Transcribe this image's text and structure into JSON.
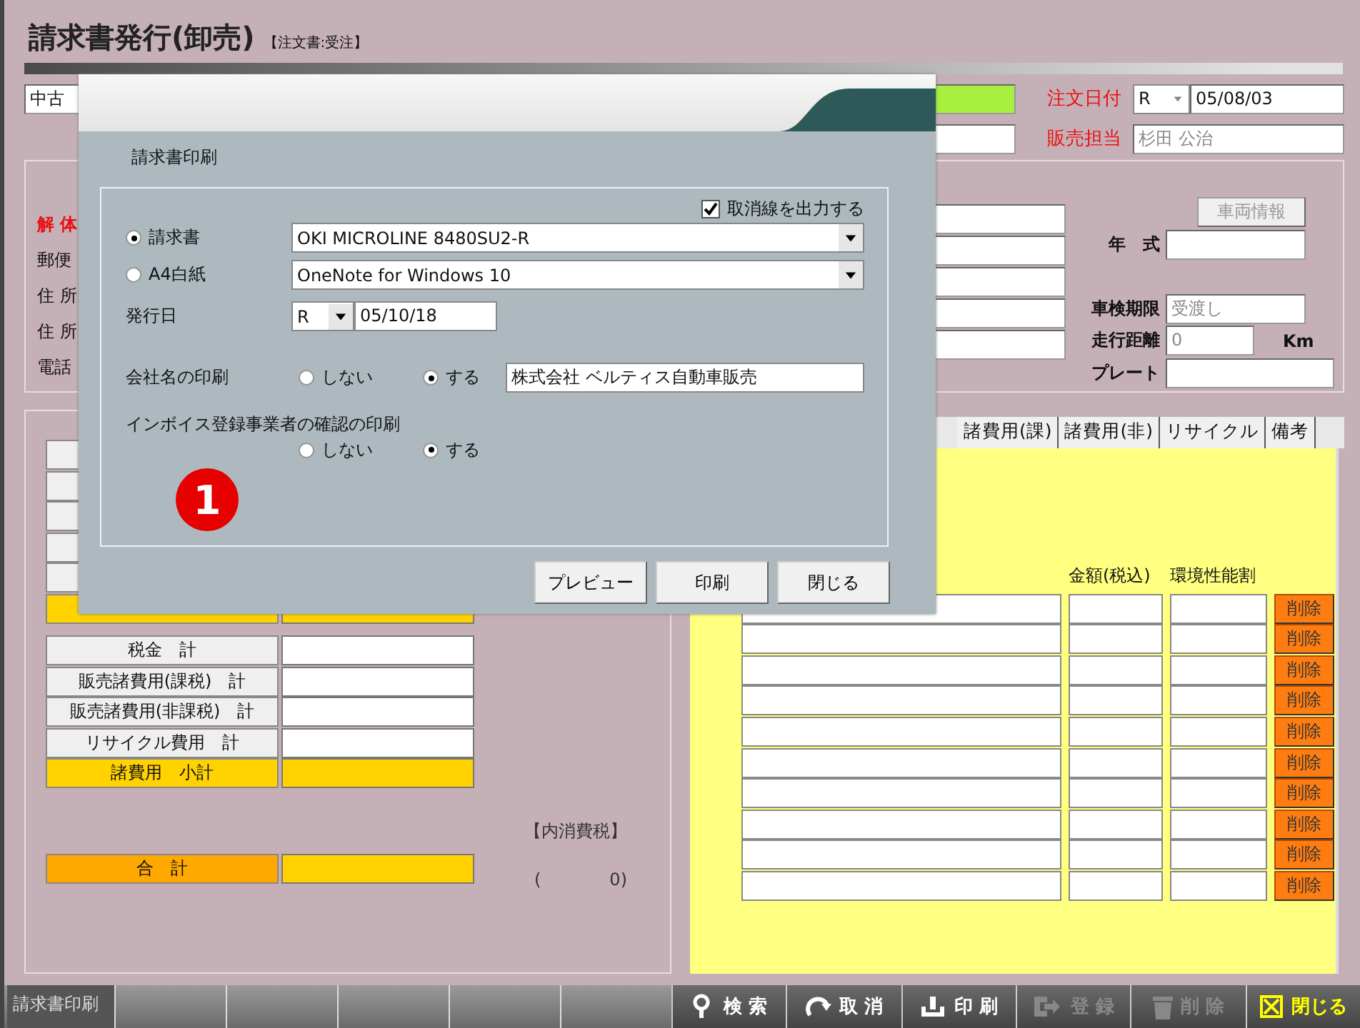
{
  "window": {
    "title": "請求書発行(卸売)",
    "subtitle": "【注文書:受注】"
  },
  "header": {
    "category": "中古",
    "order_date_label": "注文日付",
    "order_date_era": "R",
    "order_date": "05/08/03",
    "sales_rep_label": "販売担当",
    "sales_rep": "杉田 公治"
  },
  "customer": {
    "labels": [
      {
        "text": "解 体",
        "kind": "alert"
      },
      {
        "text": "郵便",
        "kind": "plain"
      },
      {
        "text": "住 所",
        "kind": "plain"
      },
      {
        "text": "住 所",
        "kind": "plain"
      },
      {
        "text": "電話",
        "kind": "plain"
      }
    ]
  },
  "vehicle": {
    "info_button": {
      "label": "車両情報",
      "disabled": true
    },
    "year_label": "年　式",
    "inspection_label": "車検期限",
    "inspection": "受渡し",
    "mileage_label": "走行距離",
    "mileage": "0",
    "mileage_unit": "Km",
    "plate_label": "プレート"
  },
  "totals": [
    {
      "label": "税金　計",
      "kind": "item"
    },
    {
      "label": "販売諸費用(課税)　計",
      "kind": "item"
    },
    {
      "label": "販売諸費用(非課税)　計",
      "kind": "item"
    },
    {
      "label": "リサイクル費用　計",
      "kind": "item"
    },
    {
      "label": "諸費用　小計",
      "kind": "subtotal"
    }
  ],
  "grand_total": {
    "label": "合　計"
  },
  "tax_note": {
    "label": "【内消費税】",
    "value": "(　　　　0)"
  },
  "tabs": [
    {
      "label": "諸費用(課)",
      "selected": false
    },
    {
      "label": "諸費用(非)",
      "selected": false
    },
    {
      "label": "リサイクル",
      "selected": false
    },
    {
      "label": "備考",
      "selected": false
    }
  ],
  "fees": {
    "columns": [
      "金額(税込)",
      "環境性能割"
    ],
    "rows": [
      {
        "action": "削除"
      },
      {
        "action": "削除"
      },
      {
        "action": "削除"
      },
      {
        "action": "削除"
      },
      {
        "action": "削除"
      },
      {
        "action": "削除"
      },
      {
        "action": "削除"
      },
      {
        "action": "削除"
      },
      {
        "action": "削除"
      },
      {
        "action": "削除"
      }
    ]
  },
  "toolbar": {
    "tab": "請求書印刷",
    "buttons": [
      {
        "label": "検 索",
        "kind": "search",
        "disabled": false
      },
      {
        "label": "取 消",
        "kind": "undo",
        "disabled": false
      },
      {
        "label": "印 刷",
        "kind": "print",
        "disabled": false
      },
      {
        "label": "登 録",
        "kind": "save",
        "disabled": true
      },
      {
        "label": "削 除",
        "kind": "delete",
        "disabled": true
      },
      {
        "label": "閉じる",
        "kind": "close",
        "disabled": false
      }
    ]
  },
  "dialog": {
    "title": "請求書印刷",
    "strike": {
      "label": "取消線を出力する",
      "checked": true
    },
    "outputs": [
      {
        "label": "請求書",
        "selected": true,
        "printer": "OKI MICROLINE 8480SU2-R"
      },
      {
        "label": "A4白紙",
        "selected": false,
        "printer": "OneNote for Windows 10"
      }
    ],
    "issue_date": {
      "label": "発行日",
      "era": "R",
      "date": "05/10/18"
    },
    "company_print": {
      "label": "会社名の印刷",
      "options": [
        {
          "label": "しない",
          "selected": false
        },
        {
          "label": "する",
          "selected": true
        }
      ],
      "company": "株式会社 ベルティス自動車販売"
    },
    "invoice_print": {
      "label": "インボイス登録事業者の確認の印刷",
      "options": [
        {
          "label": "しない",
          "selected": false
        },
        {
          "label": "する",
          "selected": true
        }
      ]
    },
    "buttons": [
      "プレビュー",
      "印刷",
      "閉じる"
    ]
  },
  "annotation_badge": "1"
}
